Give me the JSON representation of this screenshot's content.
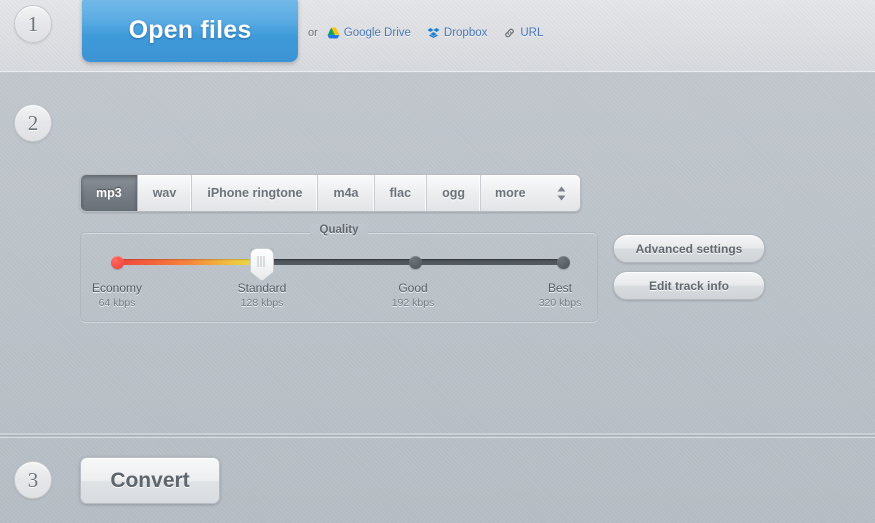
{
  "steps": {
    "one": "1",
    "two": "2",
    "three": "3"
  },
  "step1": {
    "open_files_label": "Open files",
    "or_label": "or",
    "links": [
      {
        "label": "Google Drive",
        "icon": "google-drive-icon"
      },
      {
        "label": "Dropbox",
        "icon": "dropbox-icon"
      },
      {
        "label": "URL",
        "icon": "link-icon"
      }
    ]
  },
  "step2": {
    "formats": [
      {
        "label": "mp3",
        "active": true
      },
      {
        "label": "wav",
        "active": false
      },
      {
        "label": "iPhone ringtone",
        "active": false
      },
      {
        "label": "m4a",
        "active": false
      },
      {
        "label": "flac",
        "active": false
      },
      {
        "label": "ogg",
        "active": false
      },
      {
        "label": "more",
        "active": false
      }
    ],
    "spinner_icon": "up-down-chevron-icon",
    "quality": {
      "legend": "Quality",
      "selected": "Standard",
      "stops": [
        {
          "name": "Economy",
          "rate": "64 kbps",
          "position": 0
        },
        {
          "name": "Standard",
          "rate": "128 kbps",
          "position": 33
        },
        {
          "name": "Good",
          "rate": "192 kbps",
          "position": 67
        },
        {
          "name": "Best",
          "rate": "320 kbps",
          "position": 100
        }
      ]
    },
    "advanced_settings_label": "Advanced settings",
    "edit_track_info_label": "Edit track info"
  },
  "step3": {
    "convert_label": "Convert"
  },
  "colors": {
    "accent_blue": "#4ea3de",
    "background": "#b9c0c7",
    "panel_light": "#dfe1e4",
    "link_blue": "#4a77b5",
    "quality_low": "#f0453c",
    "quality_mid": "#e8e24a",
    "track_dark": "#4b5158"
  }
}
